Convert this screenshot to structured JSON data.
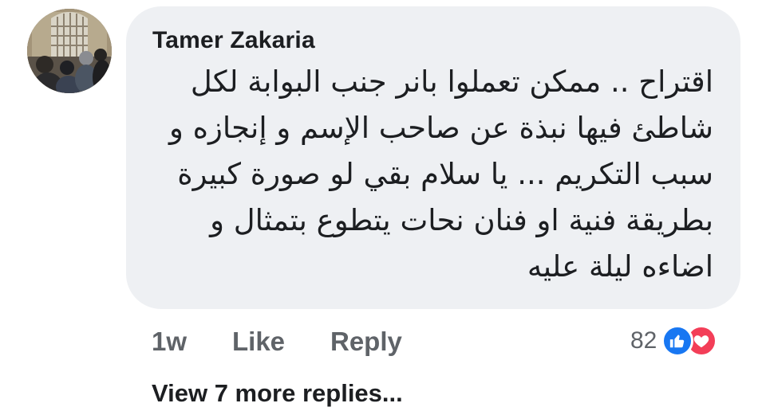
{
  "comment": {
    "author": "Tamer Zakaria",
    "text_lines": [
      "اقتراح .. ممكن تعملوا بانر جنب البوابة لكل",
      "شاطئ فيها نبذة عن صاحب الإسم و إنجازه و",
      "سبب التكريم ... يا سلام بقي لو صورة كبيرة",
      "بطريقة فنية او فنان نحات يتطوع بتمثال و",
      "اضاءه ليلة عليه"
    ],
    "time": "1w",
    "like_label": "Like",
    "reply_label": "Reply",
    "reaction_count": "82",
    "reactions": [
      "like-icon",
      "love-icon"
    ]
  },
  "view_more_label": "View 7 more replies...",
  "colors": {
    "bubble_bg": "#eef0f3",
    "like_blue": "#1877f2",
    "love_red": "#f33e58",
    "meta_gray": "#5f6368"
  }
}
